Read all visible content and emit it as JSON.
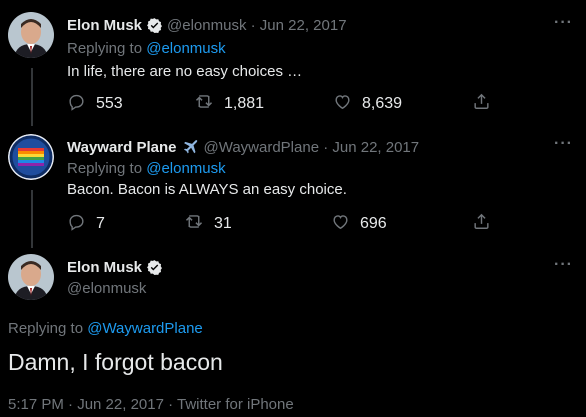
{
  "tweets": [
    {
      "name": "Elon Musk",
      "handle": "@elonmusk",
      "date": "Jun 22, 2017",
      "replying_prefix": "Replying to ",
      "replying_to": "@elonmusk",
      "text": "In life, there are no easy choices …",
      "replies": "553",
      "retweets": "1,881",
      "likes": "8,639"
    },
    {
      "name": "Wayward Plane",
      "name_emoji": "✈️",
      "handle": "@WaywardPlane",
      "date": "Jun 22, 2017",
      "replying_prefix": "Replying to ",
      "replying_to": "@elonmusk",
      "text": "Bacon. Bacon is ALWAYS an easy choice.",
      "replies": "7",
      "retweets": "31",
      "likes": "696"
    }
  ],
  "main": {
    "name": "Elon Musk",
    "handle": "@elonmusk",
    "replying_prefix": "Replying to ",
    "replying_to": "@WaywardPlane",
    "text": "Damn, I forgot bacon",
    "meta": "5:17 PM · Jun 22, 2017 · Twitter for iPhone"
  },
  "separator": " · ",
  "more_label": "···",
  "colors": {
    "link": "#1d9bf0",
    "verified": "#e7e9ea",
    "muted": "#71767b"
  },
  "icons": [
    "verified-badge-icon",
    "reply-icon",
    "retweet-icon",
    "like-icon",
    "share-icon",
    "more-icon"
  ]
}
